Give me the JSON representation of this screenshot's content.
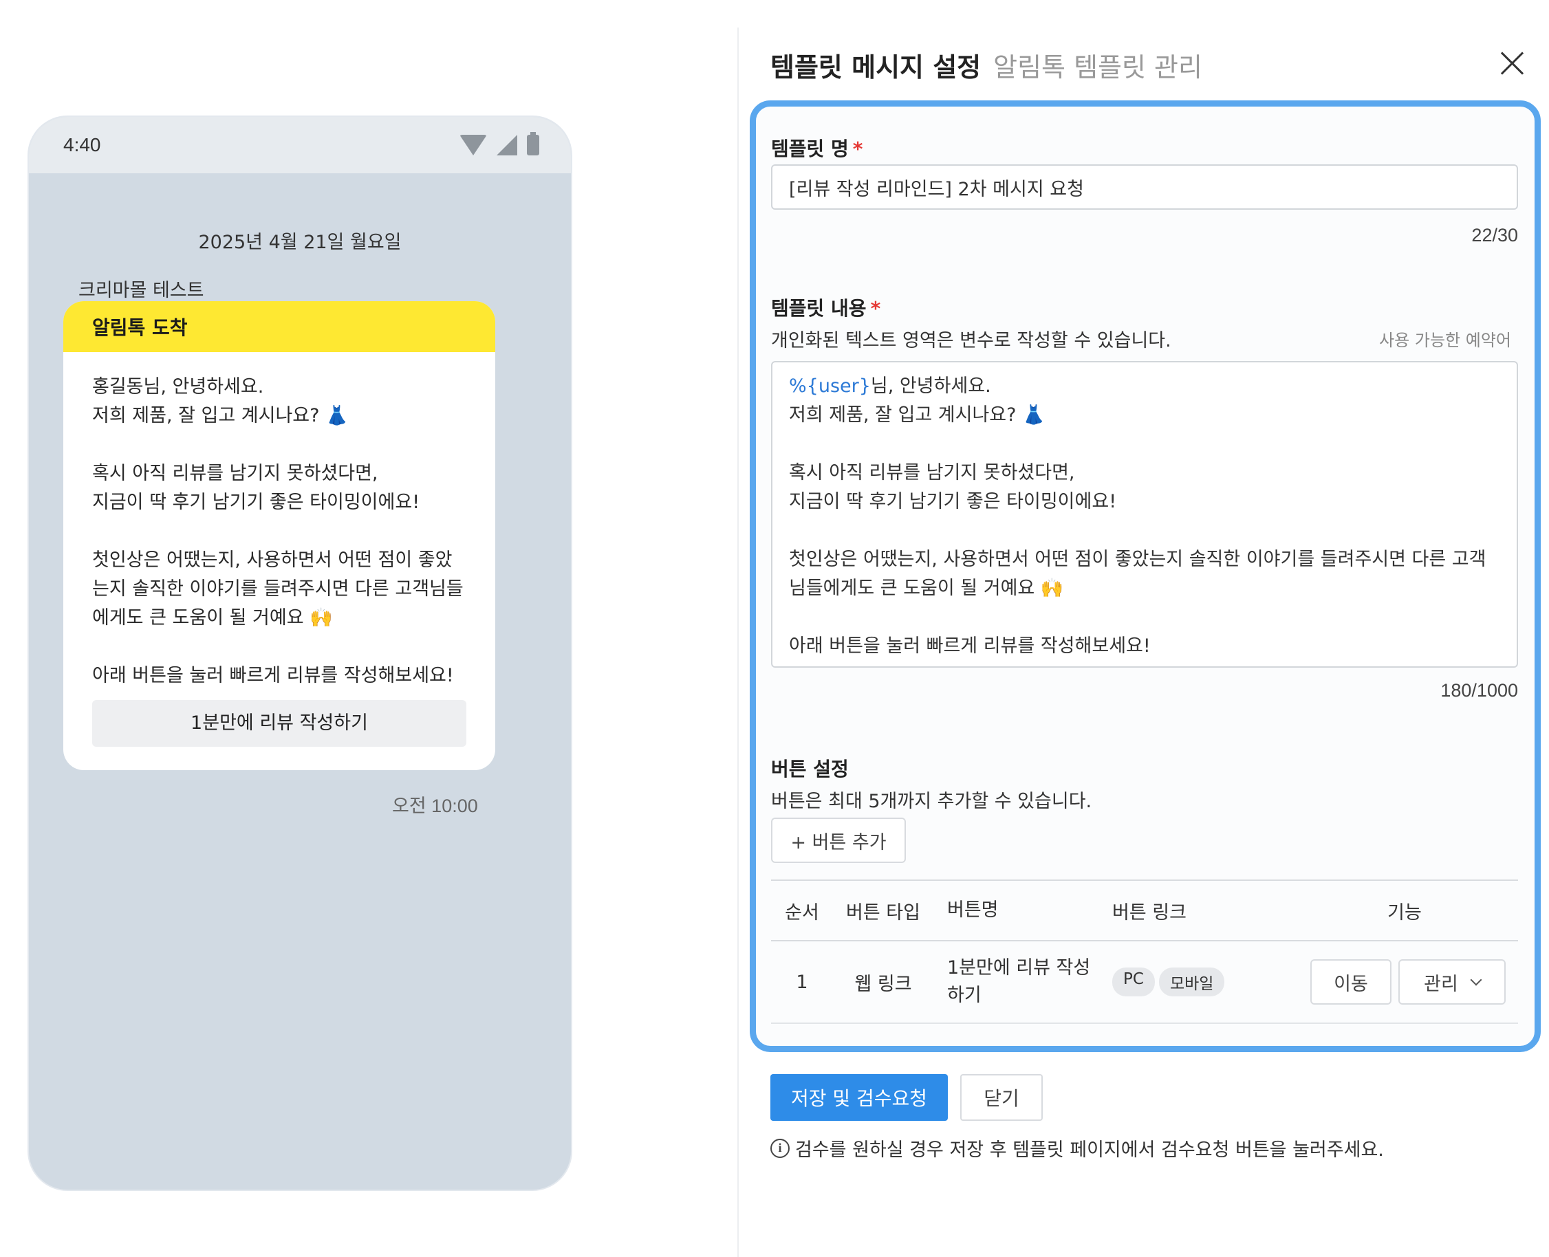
{
  "phone": {
    "time": "4:40",
    "chat_date": "2025년 4월 21일 월요일",
    "sender": "크리마몰 테스트",
    "bubble_title": "알림톡 도착",
    "message": "홍길동님, 안녕하세요.\n저희 제품, 잘 입고 계시나요? 👗\n\n혹시 아직 리뷰를 남기지 못하셨다면,\n지금이 딱 후기 남기기 좋은 타이밍이에요!\n\n첫인상은 어땠는지, 사용하면서 어떤 점이 좋았는지 솔직한 이야기를 들려주시면 다른 고객님들에게도 큰 도움이 될 거예요 🙌\n\n아래 버튼을 눌러 빠르게 리뷰를 작성해보세요!",
    "button_label": "1분만에 리뷰 작성하기",
    "sent_time": "오전 10:00"
  },
  "panel": {
    "title": "템플릿 메시지 설정",
    "subtitle": "알림톡 템플릿 관리",
    "close_icon": "close-icon"
  },
  "form": {
    "name_label": "템플릿 명",
    "required_mark": "*",
    "name_value": "[리뷰 작성 리마인드] 2차 메시지 요청",
    "name_count": "22/30",
    "content_label": "템플릿 내용",
    "content_hint": "개인화된 텍스트 영역은 변수로 작성할 수 있습니다.",
    "reserved_words_link": "사용 가능한 예약어",
    "content_variable": "%{user}",
    "content_text": "님, 안녕하세요.\n저희 제품, 잘 입고 계시나요? 👗\n\n혹시 아직 리뷰를 남기지 못하셨다면,\n지금이 딱 후기 남기기 좋은 타이밍이에요!\n\n첫인상은 어땠는지, 사용하면서 어떤 점이 좋았는지 솔직한 이야기를 들려주시면 다른 고객님들에게도 큰 도움이 될 거예요 🙌\n\n아래 버튼을 눌러 빠르게 리뷰를 작성해보세요!",
    "content_count": "180/1000",
    "button_section_label": "버튼 설정",
    "button_hint": "버튼은 최대 5개까지 추가할 수 있습니다.",
    "add_button_label": "+ 버튼 추가"
  },
  "table": {
    "headers": [
      "순서",
      "버튼 타입",
      "버튼명",
      "버튼 링크",
      "기능"
    ],
    "rows": [
      {
        "order": "1",
        "type": "웹 링크",
        "name": "1분만에 리뷰 작성하기",
        "links": [
          "PC",
          "모바일"
        ],
        "move_label": "이동",
        "manage_label": "관리"
      }
    ]
  },
  "actions": {
    "save_label": "저장 및 검수요청",
    "close_label": "닫기",
    "notice": "검수를 원하실 경우 저장 후 템플릿 페이지에서 검수요청 버튼을 눌러주세요."
  }
}
